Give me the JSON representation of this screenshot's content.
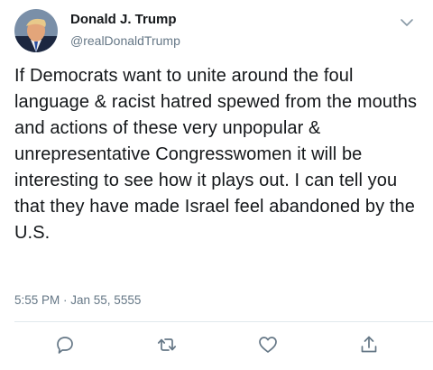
{
  "user": {
    "display_name": "Donald J. Trump",
    "handle": "@realDonaldTrump"
  },
  "tweet": {
    "text": "If Democrats want to unite around the foul language & racist hatred spewed from the mouths and actions of these very unpopular & unrepresentative Congresswomen it will be interesting to see how it plays out. I can tell you that they have made Israel feel abandoned by the U.S.",
    "timestamp": "5:55 PM · Jan 55, 5555"
  },
  "icons": {
    "menu": "chevron-down-icon",
    "reply": "reply-icon",
    "retweet": "retweet-icon",
    "like": "heart-icon",
    "share": "share-icon"
  },
  "colors": {
    "text": "#14171a",
    "secondary": "#657786",
    "divider": "#e1e8ed"
  }
}
